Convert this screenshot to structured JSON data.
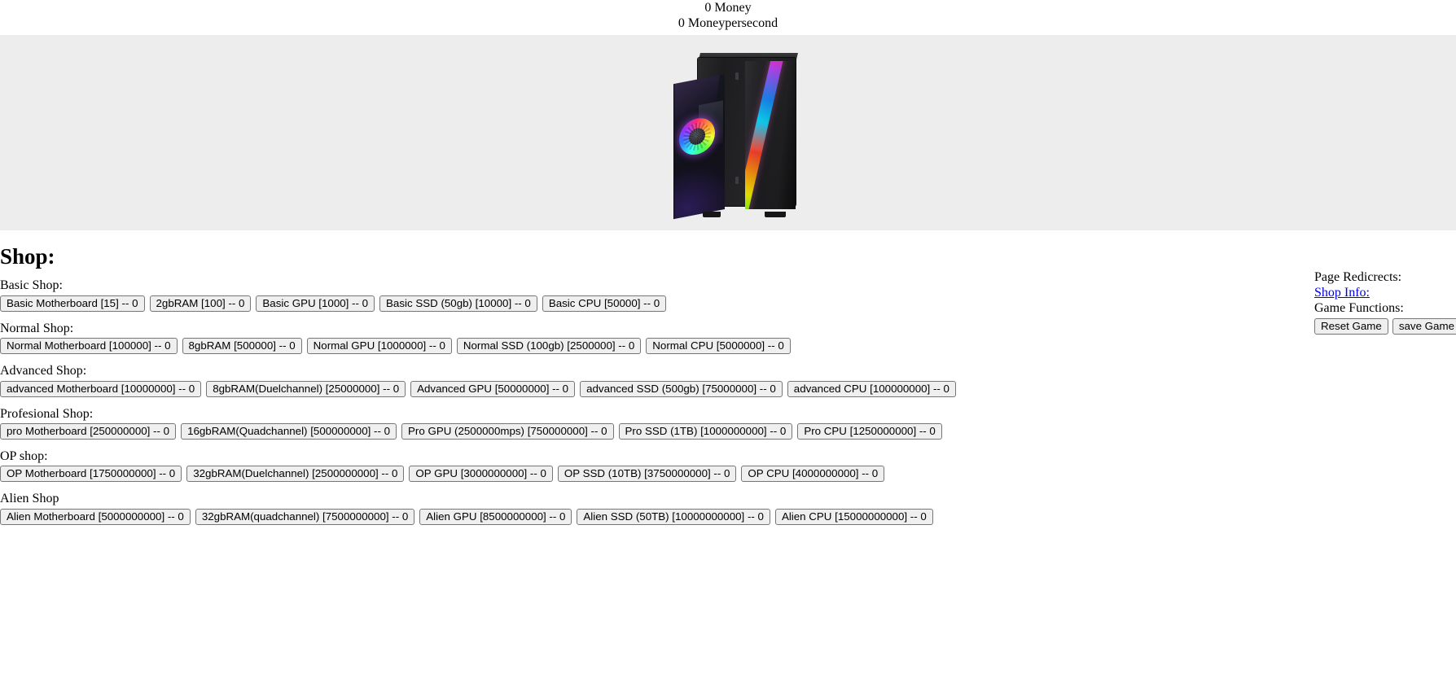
{
  "counters": {
    "money": "0 Money",
    "money_per_second": "0 Moneypersecond"
  },
  "hero": {
    "image_name": "pc-tower-case-rgb"
  },
  "shop": {
    "heading": "Shop:",
    "sections": [
      {
        "label": "Basic Shop:",
        "items": [
          "Basic Motherboard [15] -- 0",
          "2gbRAM [100] -- 0",
          "Basic GPU [1000] -- 0",
          "Basic SSD (50gb) [10000] -- 0",
          "Basic CPU [50000] -- 0"
        ]
      },
      {
        "label": "Normal Shop:",
        "items": [
          "Normal Motherboard [100000] -- 0",
          "8gbRAM [500000] -- 0",
          "Normal GPU [1000000] -- 0",
          "Normal SSD (100gb) [2500000] -- 0",
          "Normal CPU [5000000] -- 0"
        ]
      },
      {
        "label": "Advanced Shop:",
        "items": [
          "advanced Motherboard [10000000] -- 0",
          "8gbRAM(Duelchannel) [25000000] -- 0",
          "Advanced GPU [50000000] -- 0",
          "advanced SSD (500gb) [75000000] -- 0",
          "advanced CPU [100000000] -- 0"
        ]
      },
      {
        "label": "Profesional Shop:",
        "items": [
          "pro Motherboard [250000000] -- 0",
          "16gbRAM(Quadchannel) [500000000] -- 0",
          "Pro GPU (2500000mps) [750000000] -- 0",
          "Pro SSD (1TB) [1000000000] -- 0",
          "Pro CPU [1250000000] -- 0"
        ]
      },
      {
        "label": "OP shop:",
        "items": [
          "OP Motherboard [1750000000] -- 0",
          "32gbRAM(Duelchannel) [2500000000] -- 0",
          "OP GPU [3000000000] -- 0",
          "OP SSD (10TB) [3750000000] -- 0",
          "OP CPU [4000000000] -- 0"
        ]
      },
      {
        "label": "Alien Shop",
        "items": [
          "Alien Motherboard [5000000000] -- 0",
          "32gbRAM(quadchannel) [7500000000] -- 0",
          "Alien GPU [8500000000] -- 0",
          "Alien SSD (50TB) [10000000000] -- 0",
          "Alien CPU [15000000000] -- 0"
        ]
      }
    ]
  },
  "side_panel": {
    "redirects_label": "Page Redicrects:",
    "shop_info_link": "Shop Info:",
    "functions_label": "Game Functions:",
    "reset_button": "Reset Game",
    "save_button": "save Game"
  },
  "colors": {
    "band_background": "#ededed",
    "link": "#0000ee",
    "button_face": "#efefef",
    "button_border": "#767676"
  }
}
